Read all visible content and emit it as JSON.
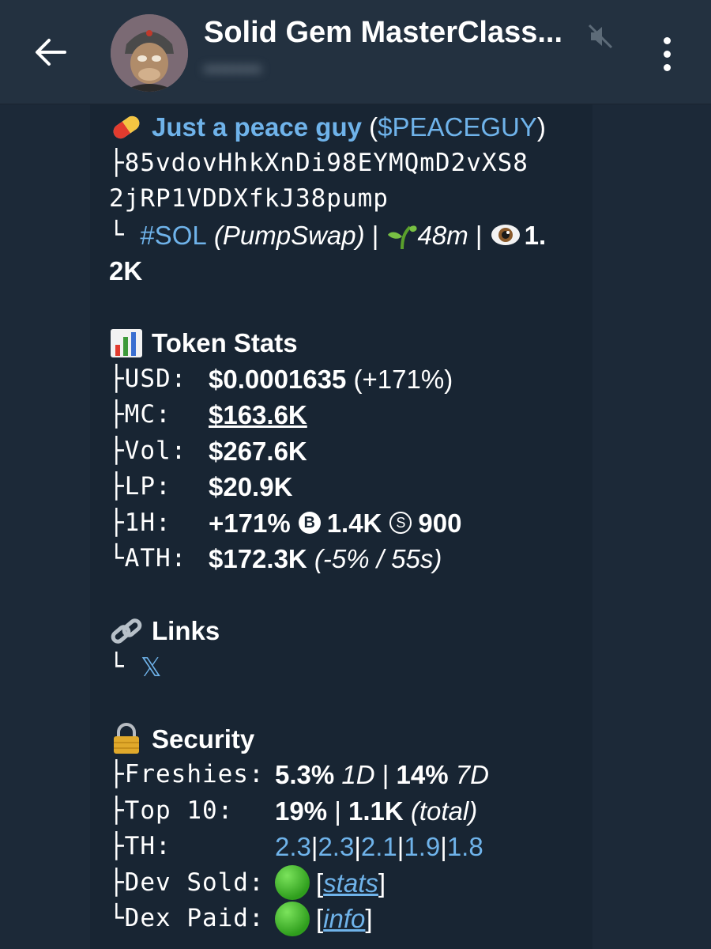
{
  "header": {
    "title": "Solid Gem MasterClass...",
    "subtitle": "••••••••"
  },
  "message": {
    "token_name": "Just a peace guy",
    "ticker_open": " (",
    "ticker": "$PEACEGUY",
    "ticker_close": ")",
    "address_line1": "├85vdovHhkXnDi98EYMQmD2vXS8",
    "address_line2": "2jRP1VDDXfkJ38pump",
    "chain_prefix": "└ ",
    "chain_tag": "#SOL",
    "dex": " (PumpSwap)",
    "sep1": " | ",
    "age": "48m",
    "sep2": " | ",
    "views_part1": "1.",
    "views_part2": "2K",
    "stats_heading": "Token Stats",
    "stats": [
      {
        "key": "├USD:",
        "value": "$0.0001635",
        "extra": " (+171%)"
      },
      {
        "key": "├MC:",
        "value": "$163.6K",
        "extra": ""
      },
      {
        "key": "├Vol:",
        "value": "$267.6K",
        "extra": ""
      },
      {
        "key": "├LP:",
        "value": "$20.9K",
        "extra": ""
      },
      {
        "key": "├1H:",
        "value": "+171%",
        "extra": ""
      },
      {
        "key": "└ATH:",
        "value": "$172.3K",
        "extra": " (-5% / 55s)"
      }
    ],
    "buys_icon": "B",
    "buys": "1.4K",
    "sells_icon": "S",
    "sells": "900",
    "links_heading": "Links",
    "links_prefix": "└",
    "x_link": "𝕏",
    "security_heading": "Security",
    "freshies_key": "├Freshies:",
    "freshies_1d": "5.3%",
    "freshies_1d_label": " 1D",
    "freshies_sep": " | ",
    "freshies_7d": "14%",
    "freshies_7d_label": " 7D",
    "top10_key": "├Top 10:",
    "top10_pct": "19%",
    "top10_sep": " | ",
    "top10_total": "1.1K",
    "top10_total_label": " (total)",
    "th_key": "├TH:",
    "th_values": [
      "2.3",
      "2.3",
      "2.1",
      "1.9",
      "1.8"
    ],
    "dev_sold_key": "├Dev Sold:",
    "dev_sold_link": "stats",
    "dex_paid_key": "└Dex Paid:",
    "dex_paid_link": "info"
  },
  "colors": {
    "background": "#1c2938",
    "header": "#233140",
    "bubble": "#182533",
    "link": "#6fb3ea",
    "status_green": "#3fb52a"
  },
  "icons": [
    "back-arrow-icon",
    "mute-icon",
    "more-vertical-icon",
    "pill-icon",
    "seedling-icon",
    "eye-icon",
    "bar-chart-icon",
    "link-icon",
    "lock-icon",
    "green-circle-icon"
  ]
}
